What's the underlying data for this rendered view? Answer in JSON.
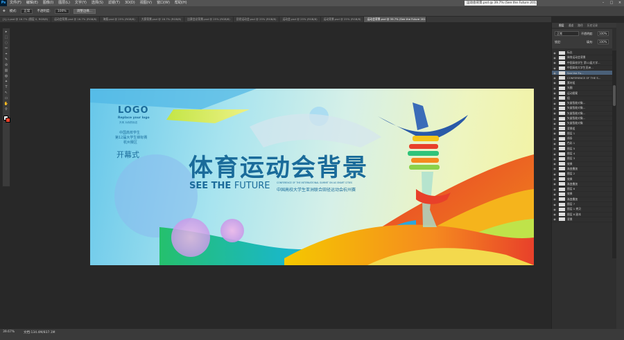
{
  "app": {
    "logo": "Ps",
    "window_title": "运动会背景.psd @ 39.7% (See the Future 2011, RGB/8)"
  },
  "menu": [
    "文件(F)",
    "编辑(E)",
    "图像(I)",
    "图层(L)",
    "文字(Y)",
    "选择(S)",
    "滤镜(T)",
    "3D(D)",
    "视图(V)",
    "窗口(W)",
    "帮助(H)"
  ],
  "window_controls": [
    "–",
    "□",
    "×"
  ],
  "options": {
    "mode_label": "模式:",
    "mode_value": "正常",
    "opacity_label": "不透明度:",
    "opacity_value": "100%",
    "btn_label": "调整边缘..."
  },
  "tabs": [
    {
      "label": "[1]-1.psd @ 16.7% (图层 0, RGB/8)",
      "active": false
    },
    {
      "label": "运动会背景.psd @ 16.7% (RGB/8)",
      "active": false
    },
    {
      "label": "海报.psd @ 25% (RGB/8)",
      "active": false
    },
    {
      "label": "大赛背景.psd @ 16.7% (RGB/8)",
      "active": false
    },
    {
      "label": "比赛会议背景.psd @ 25% (RGB/8)",
      "active": false
    },
    {
      "label": "田径运动会.psd @ 25% (RGB/8)",
      "active": false
    },
    {
      "label": "运动会.psd @ 25% (RGB/8)",
      "active": false
    },
    {
      "label": "运动背景.psd @ 25% (RGB/8)",
      "active": false
    },
    {
      "label": "运动会背景.psd @ 39.7% (See the Future 2011, RGB/8)",
      "active": true
    }
  ],
  "tools": [
    "▸",
    "⬚",
    "◌",
    "✂",
    "⌖",
    "✎",
    "⊘",
    "▥",
    "◍",
    "✦",
    "T",
    "↖",
    "▭",
    "✋",
    "⚲"
  ],
  "design": {
    "logo": "LOGO",
    "logo_sub": "Replace your logo",
    "logo_sub2": "升风 为你的标志",
    "org_line1": "中国高校学生",
    "org_line2": "第12届大学生锦标赛",
    "org_line3": "杭州赛区",
    "opening": "开幕式",
    "title": "体育运动会背景",
    "see": "SEE THE ",
    "future": "FUTURE",
    "conf_en_1": "CONFERENCE OF THE INTERNATIONAL SUMMIT ON AS SMART CITIES",
    "conf_cn": "中国高校大学生亚洲联合田径运动会杭州赛",
    "colors": {
      "title": "#1a6b9a",
      "green": "#2fc37a",
      "yellow": "#f2c51a",
      "red": "#e8402a",
      "teal": "#12b3a8"
    }
  },
  "panels": {
    "tabs": [
      "图层",
      "通道",
      "路径",
      "历史记录"
    ],
    "blend_label": "正常",
    "opacity_label": "不透明度:",
    "opacity_value": "100%",
    "lock_label": "锁定:",
    "fill_label": "填充:",
    "fill_value": "100%"
  },
  "layers": [
    {
      "name": "标志",
      "sel": false
    },
    {
      "name": "体育运动会背景",
      "sel": false
    },
    {
      "name": "中国高校学生 第12届大学...",
      "sel": false
    },
    {
      "name": "中国高校大学生亚洲...",
      "sel": false
    },
    {
      "name": "See the Fu...",
      "sel": true
    },
    {
      "name": "CONFERENCE OF THE S...",
      "sel": false
    },
    {
      "name": "素材组",
      "sel": false
    },
    {
      "name": "光圈",
      "sel": false
    },
    {
      "name": "运动图案",
      "sel": false
    },
    {
      "name": "组",
      "sel": false
    },
    {
      "name": "矢量智能对象...",
      "sel": false
    },
    {
      "name": "矢量智能对象...",
      "sel": false
    },
    {
      "name": "矢量智能对象...",
      "sel": false
    },
    {
      "name": "矢量智能对象...",
      "sel": false
    },
    {
      "name": "矢量智能对象",
      "sel": false
    },
    {
      "name": "背景组",
      "sel": false
    },
    {
      "name": "图层 1",
      "sel": false
    },
    {
      "name": "线条",
      "sel": false
    },
    {
      "name": "色彩 1",
      "sel": false
    },
    {
      "name": "图层 5",
      "sel": false
    },
    {
      "name": "图层 4",
      "sel": false
    },
    {
      "name": "图层 3",
      "sel": false
    },
    {
      "name": "效果",
      "sel": false
    },
    {
      "name": "渐变叠加",
      "sel": false
    },
    {
      "name": "图层 2",
      "sel": false
    },
    {
      "name": "效果",
      "sel": false
    },
    {
      "name": "渐变叠加",
      "sel": false
    },
    {
      "name": "图层 6",
      "sel": false
    },
    {
      "name": "效果",
      "sel": false
    },
    {
      "name": "渐变叠加",
      "sel": false
    },
    {
      "name": "图层 7",
      "sel": false
    },
    {
      "name": "图层 1 拷贝",
      "sel": false
    },
    {
      "name": "图层 8 副本",
      "sel": false
    },
    {
      "name": "背景",
      "sel": false
    }
  ],
  "status": {
    "zoom": "39.67%",
    "doc": "文档:134.4M/837.1M"
  }
}
